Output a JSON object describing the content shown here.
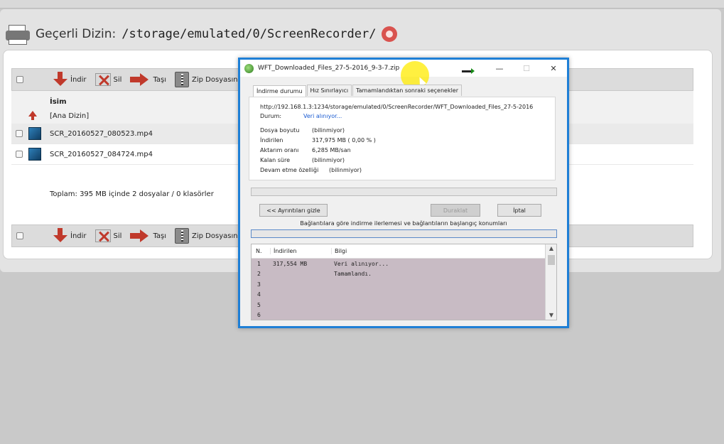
{
  "header": {
    "dir_label": "Geçerli Dizin:",
    "dir_path": "/storage/emulated/0/ScreenRecorder/"
  },
  "toolbar": {
    "download": "İndir",
    "delete": "Sil",
    "move": "Taşı",
    "zip": "Zip Dosyasın"
  },
  "table": {
    "column_name": "İsim",
    "parent_dir": "[Ana Dizin]",
    "files": [
      {
        "name": "SCR_20160527_080523.mp4"
      },
      {
        "name": "SCR_20160527_084724.mp4"
      }
    ],
    "summary": "Toplam: 395 MB içinde 2 dosyalar / 0 klasörler"
  },
  "dialog": {
    "title": "WFT_Downloaded_Files_27-5-2016_9-3-7.zip",
    "tabs": [
      "İndirme durumu",
      "Hız Sınırlayıcı",
      "Tamamlandıktan sonraki seçenekler"
    ],
    "url": "http://192.168.1.3:1234/storage/emulated/0/ScreenRecorder/WFT_Downloaded_Files_27-5-2016",
    "status_label": "Durum:",
    "status_value": "Veri alınıyor...",
    "info": [
      {
        "label": "Dosya boyutu",
        "value": "(bilinmiyor)"
      },
      {
        "label": "İndirilen",
        "value": "317,975  MB  ( 0,00 % )"
      },
      {
        "label": "Aktarım oranı",
        "value": "6,285  MB/san"
      },
      {
        "label": "Kalan süre",
        "value": "(bilinmiyor)"
      },
      {
        "label": "Devam etme özelliği",
        "value": "(bilinmiyor)"
      }
    ],
    "buttons": {
      "hide_details": "<< Ayrıntıları gizle",
      "pause": "Duraklat",
      "cancel": "İptal"
    },
    "connections_caption": "Bağlantılara göre indirme ilerlemesi ve bağlantıların başlangıç konumları",
    "list": {
      "headers": [
        "N.",
        "İndirilen",
        "Bilgi"
      ],
      "rows": [
        {
          "n": "1",
          "downloaded": "317,554 MB",
          "info": "Veri alınıyor..."
        },
        {
          "n": "2",
          "downloaded": "",
          "info": "Tamamlandı."
        },
        {
          "n": "3",
          "downloaded": "",
          "info": ""
        },
        {
          "n": "4",
          "downloaded": "",
          "info": ""
        },
        {
          "n": "5",
          "downloaded": "",
          "info": ""
        },
        {
          "n": "6",
          "downloaded": "",
          "info": ""
        }
      ]
    },
    "window_controls": {
      "minimize": "—",
      "maximize": "☐",
      "close": "✕"
    }
  },
  "colors": {
    "dialog_border": "#1e7fd6",
    "status_blue": "#1a5bd1",
    "list_bg": "#c8bbc4",
    "delete_red": "#c0392b"
  }
}
